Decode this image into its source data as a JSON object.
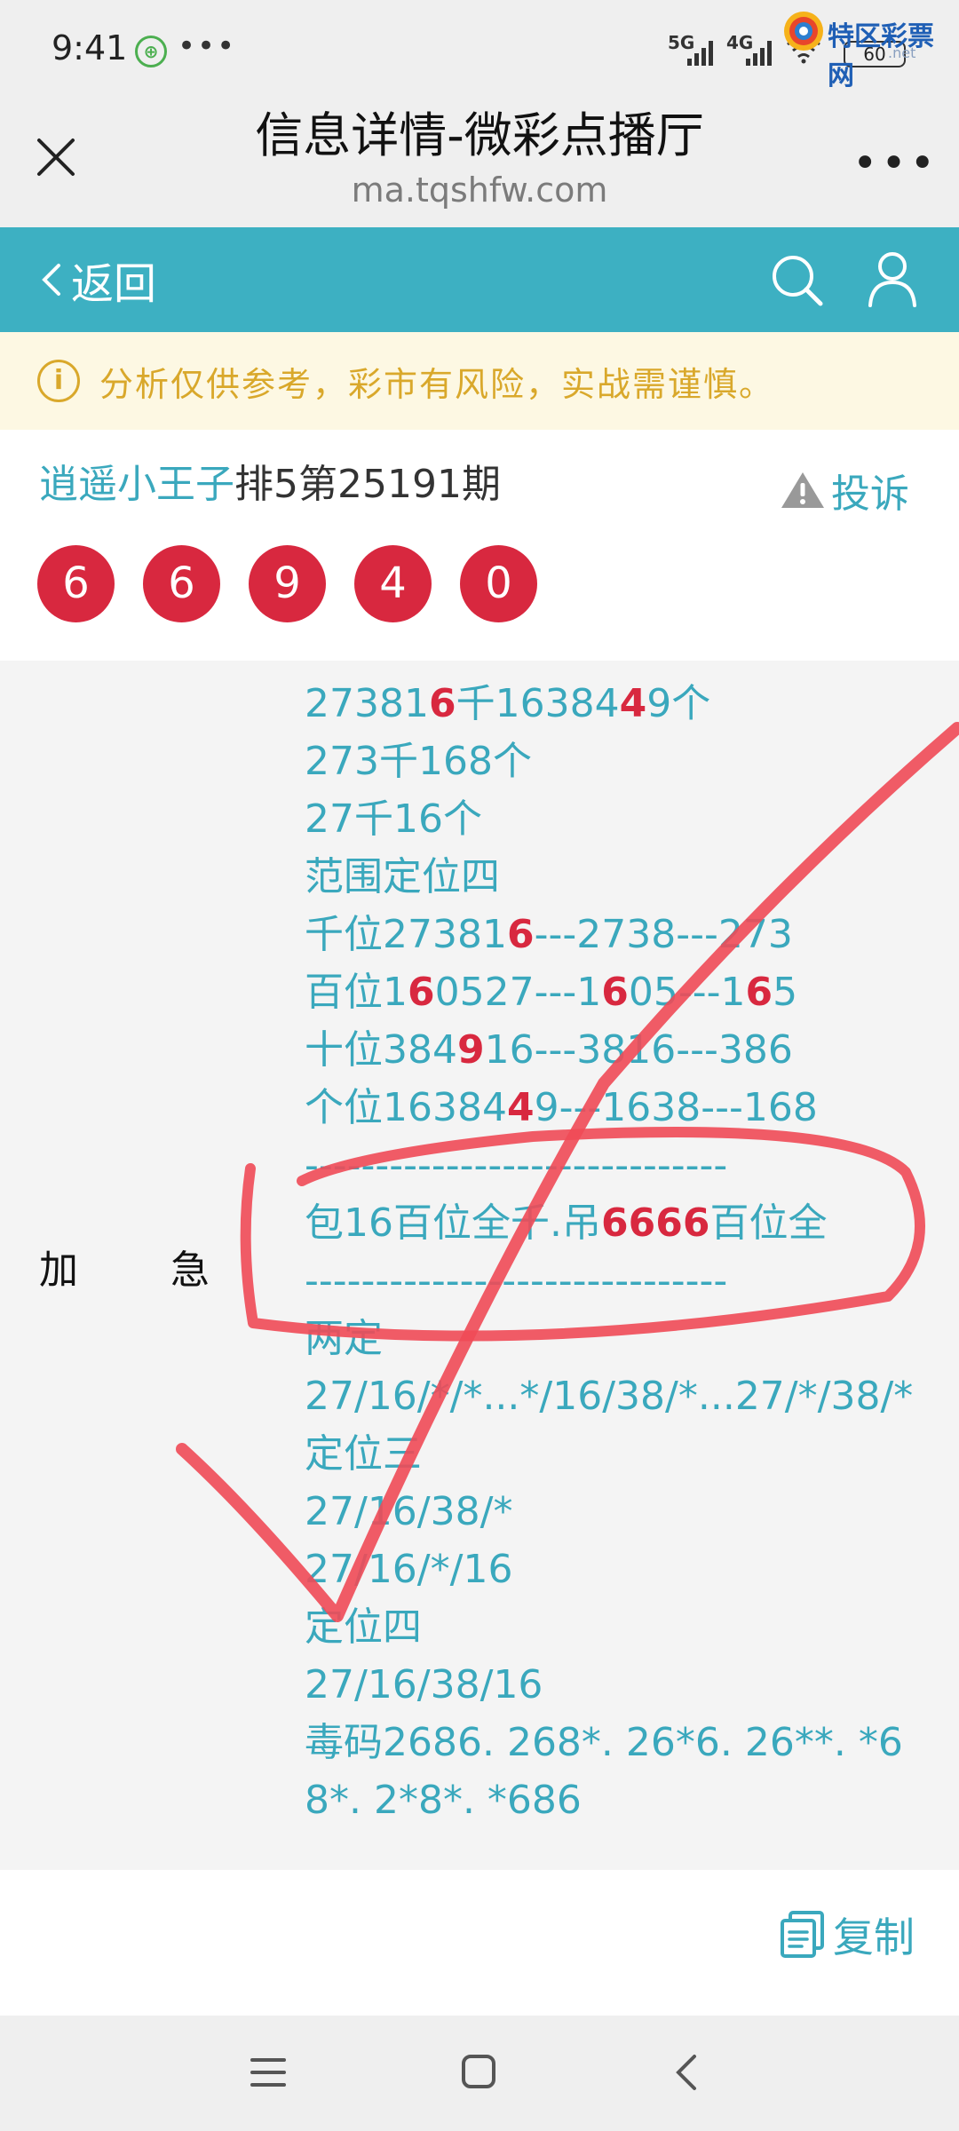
{
  "status_bar": {
    "time": "9:41",
    "app_icon_glyph": "⊕",
    "dots": "•••",
    "net1": "5G",
    "net2": "4G",
    "battery": "60"
  },
  "watermark": {
    "text": "特区彩票网",
    "sub": ".net"
  },
  "header": {
    "title": "信息详情-微彩点播厅",
    "url": "ma.tqshfw.com",
    "more": "•••"
  },
  "nav": {
    "back_label": "返回"
  },
  "notice": {
    "icon_glyph": "i",
    "text": "分析仅供参考，彩市有风险，实战需谨慎。"
  },
  "draw": {
    "author": "逍遥小王子",
    "info": "排5第25191期",
    "report_label": "投诉",
    "numbers": [
      "6",
      "6",
      "9",
      "4",
      "0"
    ]
  },
  "post": {
    "side_label": "加 急",
    "lines": [
      [
        {
          "t": "27381"
        },
        {
          "t": "6",
          "hl": true
        },
        {
          "t": "千16384"
        },
        {
          "t": "4",
          "hl": true
        },
        {
          "t": "9个"
        }
      ],
      [
        {
          "t": "273千168个"
        }
      ],
      [
        {
          "t": "27千16个"
        }
      ],
      [
        {
          "t": "范围定位四"
        }
      ],
      [
        {
          "t": "千位27381"
        },
        {
          "t": "6",
          "hl": true
        },
        {
          "t": "---2738---273"
        }
      ],
      [
        {
          "t": "百位1"
        },
        {
          "t": "6",
          "hl": true
        },
        {
          "t": "0527---1"
        },
        {
          "t": "6",
          "hl": true
        },
        {
          "t": "05---1"
        },
        {
          "t": "6",
          "hl": true
        },
        {
          "t": "5"
        }
      ],
      [
        {
          "t": "十位384"
        },
        {
          "t": "9",
          "hl": true
        },
        {
          "t": "16---3816---386"
        }
      ],
      [
        {
          "t": "个位16384"
        },
        {
          "t": "4",
          "hl": true
        },
        {
          "t": "9---1638---168"
        }
      ],
      [
        {
          "t": "------------------------------"
        }
      ],
      [
        {
          "t": "包16百位全千.吊"
        },
        {
          "t": "6666",
          "hl": true
        },
        {
          "t": "百位全"
        }
      ],
      [
        {
          "t": "------------------------------"
        }
      ],
      [
        {
          "t": "两定"
        }
      ],
      [
        {
          "t": "27/16/*/*...*/16/38/*...27/*/38/*"
        }
      ],
      [
        {
          "t": "定位三"
        }
      ],
      [
        {
          "t": "27/16/38/*"
        }
      ],
      [
        {
          "t": "27/16/*/16"
        }
      ],
      [
        {
          "t": "定位四"
        }
      ],
      [
        {
          "t": "27/16/38/16"
        }
      ],
      [
        {
          "t": "毒码2686. 268*. 26*6. 26**. *6"
        }
      ],
      [
        {
          "t": "8*. 2*8*. *686"
        }
      ]
    ]
  },
  "copy": {
    "label": "复制"
  },
  "colors": {
    "teal": "#3db0c2",
    "ball_red": "#d8283f",
    "notice_text": "#d9a82b",
    "annotation_red": "#f04a57"
  }
}
